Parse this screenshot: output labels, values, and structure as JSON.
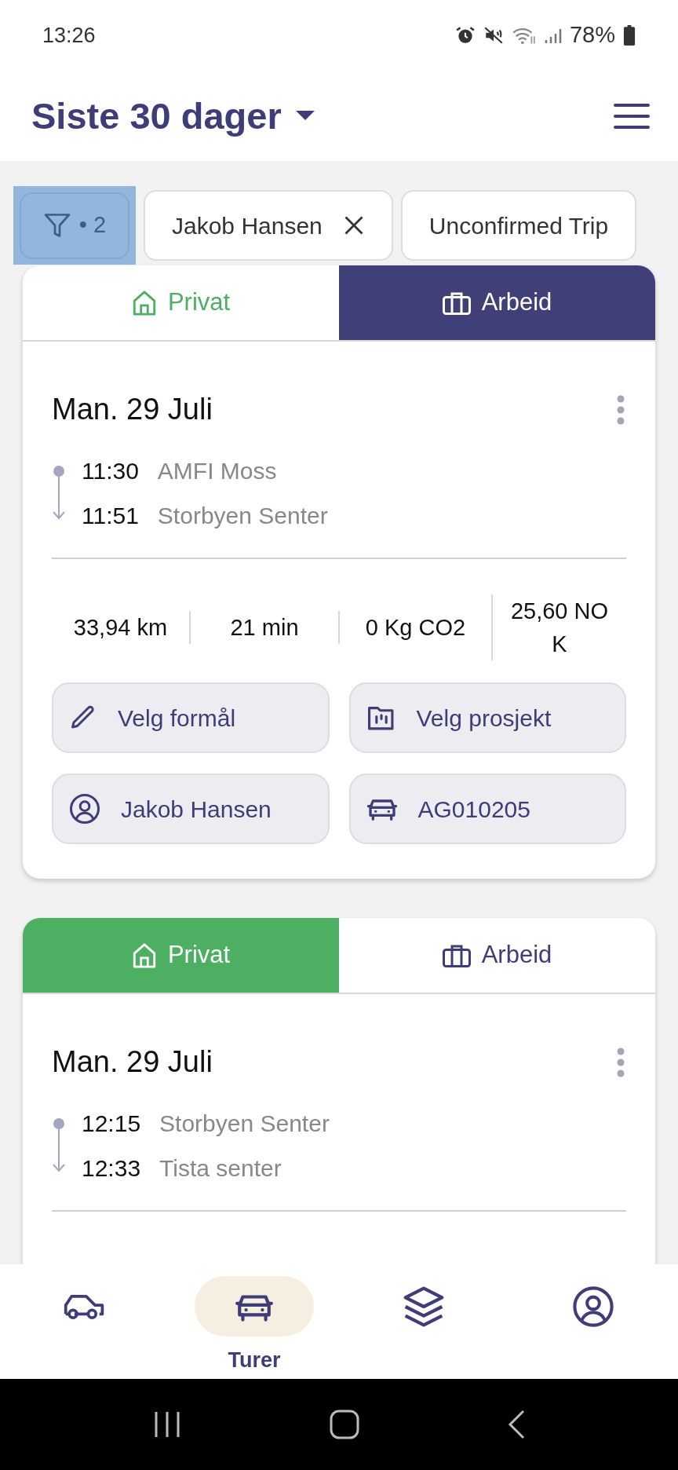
{
  "status_bar": {
    "time": "13:26",
    "battery": "78%"
  },
  "header": {
    "title": "Siste 30 dager"
  },
  "filters": {
    "button": {
      "badge": "• 2",
      "selected": true
    },
    "chips": [
      {
        "label": "Jakob Hansen",
        "removable": true
      },
      {
        "label": "Unconfirmed Trip",
        "removable": false
      }
    ]
  },
  "trips": [
    {
      "tabs": [
        {
          "kind": "private",
          "label": "Privat",
          "selected": false
        },
        {
          "kind": "work",
          "label": "Arbeid",
          "selected": true
        }
      ],
      "date": "Man. 29 Juli",
      "start": {
        "time": "11:30",
        "place": "AMFI Moss"
      },
      "end": {
        "time": "11:51",
        "place": "Storbyen Senter"
      },
      "stats": [
        "33,94 km",
        "21 min",
        "0 Kg CO2",
        "25,60 NOK"
      ],
      "actions": [
        {
          "kind": "pencil",
          "label": "Velg formål"
        },
        {
          "kind": "folder",
          "label": "Velg prosjekt"
        },
        {
          "kind": "user",
          "label": "Jakob Hansen"
        },
        {
          "kind": "car",
          "label": "AG010205"
        }
      ]
    },
    {
      "tabs": [
        {
          "kind": "private",
          "label": "Privat",
          "selected": true
        },
        {
          "kind": "work",
          "label": "Arbeid",
          "selected": false
        }
      ],
      "date": "Man. 29 Juli",
      "start": {
        "time": "12:15",
        "place": "Storbyen Senter"
      },
      "end": {
        "time": "12:33",
        "place": "Tista senter"
      }
    }
  ],
  "bottom_nav": [
    {
      "kind": "car-side",
      "selected": false
    },
    {
      "kind": "car-front",
      "label": "Turer",
      "selected": true
    },
    {
      "kind": "layers",
      "selected": false
    },
    {
      "kind": "user",
      "selected": false
    }
  ]
}
